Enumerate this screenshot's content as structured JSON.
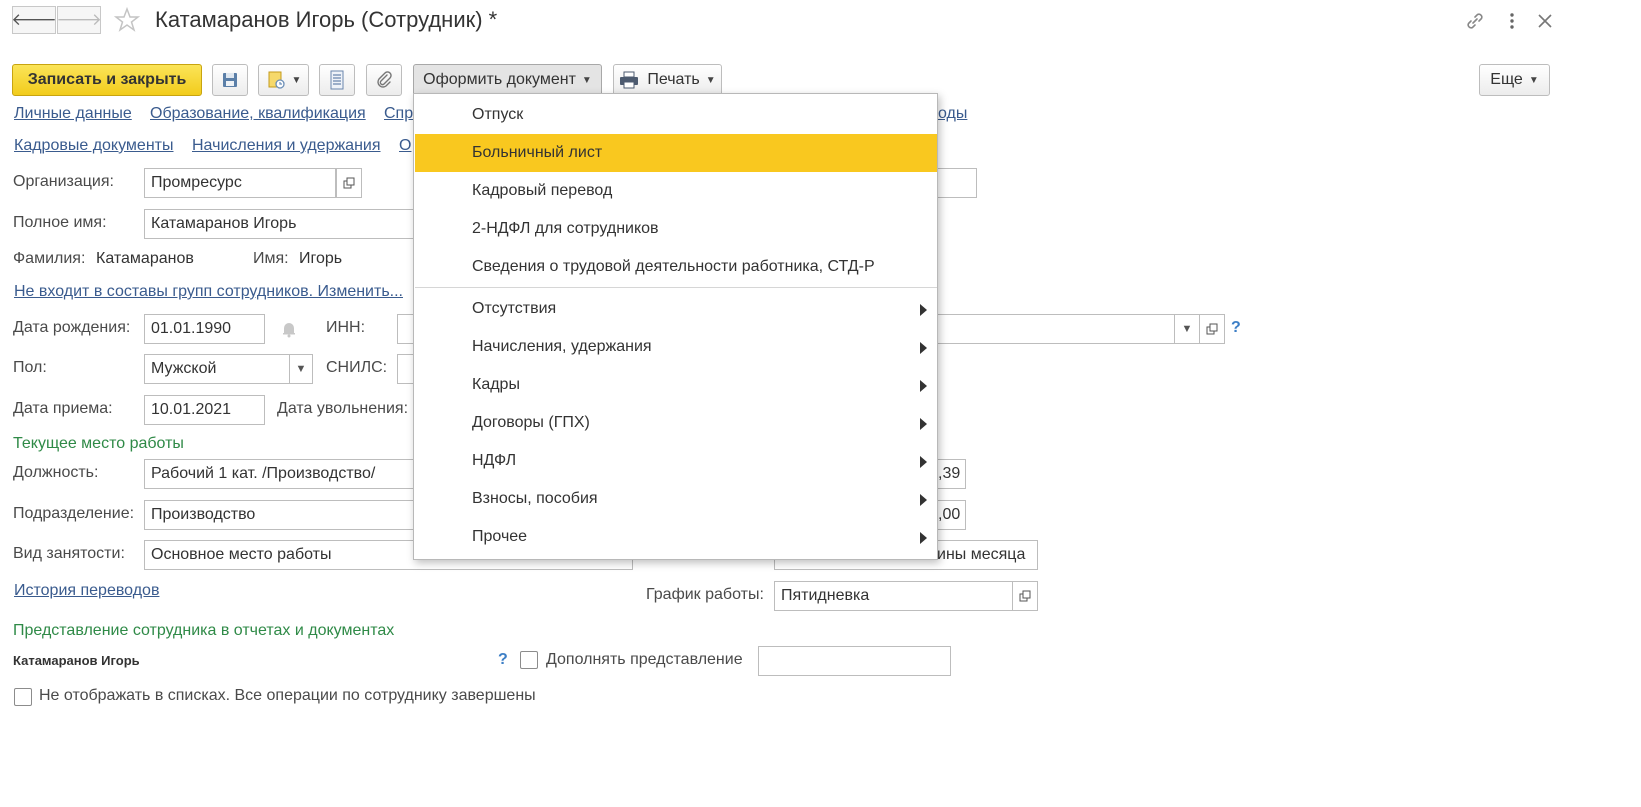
{
  "window": {
    "title": "Катамаранов Игорь (Сотрудник) *"
  },
  "toolbar": {
    "save_close": "Записать и закрыть",
    "issue_document": "Оформить документ",
    "print": "Печать",
    "more": "Еще"
  },
  "tabs": {
    "row1": [
      "Личные данные",
      "Образование, квалификация",
      "Спр",
      "оды"
    ],
    "row2": [
      "Кадровые документы",
      "Начисления и удержания",
      "О"
    ]
  },
  "form": {
    "organization_label": "Организация:",
    "organization_value": "Промресурс",
    "fullname_label": "Полное имя:",
    "fullname_value": "Катамаранов Игорь",
    "surname_label": "Фамилия:",
    "surname_value": "Катамаранов",
    "name_label": "Имя:",
    "name_value": "Игорь",
    "groups_link": "Не входит в составы групп сотрудников. Изменить...",
    "birthdate_label": "Дата рождения:",
    "birthdate_value": "01.01.1990",
    "inn_label": "ИНН:",
    "gender_label": "Пол:",
    "gender_value": "Мужской",
    "snils_label": "СНИЛС:",
    "hire_date_label": "Дата приема:",
    "hire_date_value": "10.01.2021",
    "dismissal_label": "Дата увольнения:",
    "current_job_section": "Текущее место работы",
    "position_label": "Должность:",
    "position_value": "Рабочий 1 кат. /Производство/",
    "department_label": "Подразделение:",
    "department_value": "Производство",
    "employment_type_label": "Вид занятости:",
    "employment_type_value": "Основное место работы",
    "history_link": "История переводов",
    "schedule_label": "График работы:",
    "schedule_value": "Пятидневка",
    "right_value_1": ",39",
    "right_value_2": ",00",
    "right_value_3": "ины месяца",
    "representation_section": "Представление сотрудника в отчетах и документах",
    "representation_value": "Катамаранов Игорь",
    "append_label": "Дополнять представление",
    "hide_label": "Не отображать в списках. Все операции по сотруднику завершены",
    "help_mark": "?"
  },
  "menu": {
    "items": [
      "Отпуск",
      "Больничный лист",
      "Кадровый перевод",
      "2-НДФЛ для сотрудников",
      "Сведения о трудовой деятельности работника, СТД-Р"
    ],
    "submenus": [
      "Отсутствия",
      "Начисления, удержания",
      "Кадры",
      "Договоры (ГПХ)",
      "НДФЛ",
      "Взносы, пособия",
      "Прочее"
    ],
    "highlighted_index": 1
  },
  "colors": {
    "accent_yellow": "#f9c81f",
    "link_blue": "#3a5b8e",
    "section_green": "#2f8a47"
  },
  "icons": [
    "back-arrow-icon",
    "forward-arrow-icon",
    "star-icon",
    "link-icon",
    "kebab-icon",
    "close-icon",
    "save-icon",
    "create-based-icon",
    "report-icon",
    "paperclip-icon",
    "printer-icon",
    "bell-icon",
    "open-form-icon",
    "dropdown-icon"
  ]
}
